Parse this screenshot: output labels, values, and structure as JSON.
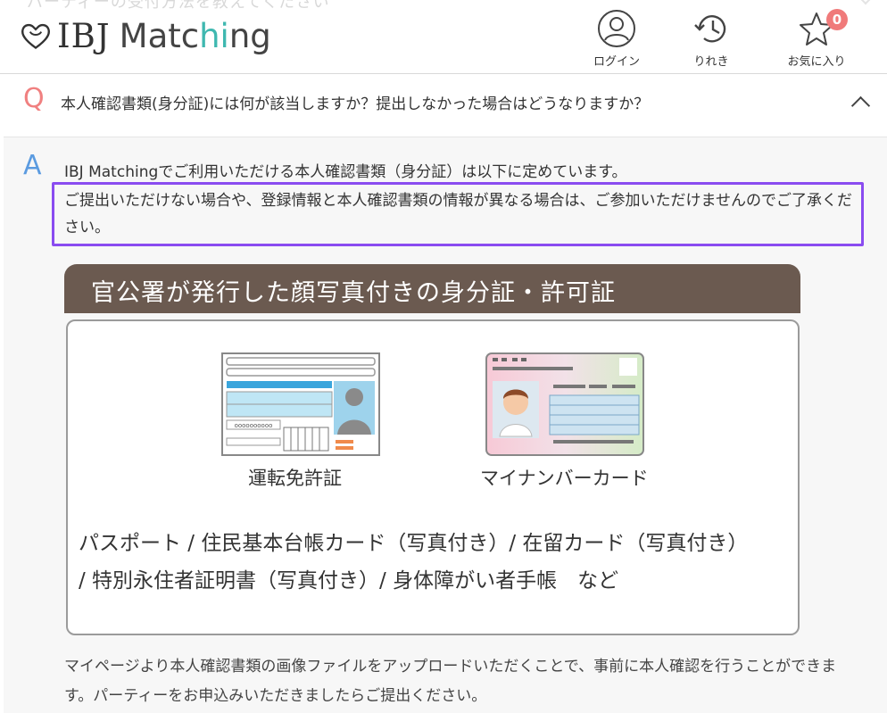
{
  "header": {
    "ghost_question": "パーティーの受付方法を教えてください",
    "logo": {
      "part1": "IBJ",
      "part2_prefix": "Matc",
      "part2_accent": "hi",
      "part2_suffix": "ng"
    },
    "nav": {
      "login": "ログイン",
      "history": "りれき",
      "favorites": "お気に入り",
      "favorites_count": "0"
    }
  },
  "faq": {
    "question_mark": "Q",
    "question": "本人確認書類(身分証)には何が該当しますか？提出しなかった場合はどうなりますか？",
    "answer_mark": "A",
    "answer_line1": "IBJ Matchingでご利用いただける本人確認書類（身分証）は以下に定めています。",
    "answer_highlight": "ご提出いただけない場合や、登録情報と本人確認書類の情報が異なる場合は、ご参加いただけませんのでご了承ください。",
    "answer_bottom": "マイページより本人確認書類の画像ファイルをアップロードいただくことで、事前に本人確認を行うことができます。パーティーをお申込みいただきましたらご提出ください。"
  },
  "figure": {
    "banner": "官公署が発行した顔写真付きの身分証・許可証",
    "card1_caption": "運転免許証",
    "card1_number": "oooooooooo",
    "card2_caption": "マイナンバーカード",
    "list_line1": "パスポート / 住民基本台帳カード（写真付き）/ 在留カード（写真付き）",
    "list_line2": "/ 特別永住者証明書（写真付き）/ 身体障がい者手帳　など"
  }
}
